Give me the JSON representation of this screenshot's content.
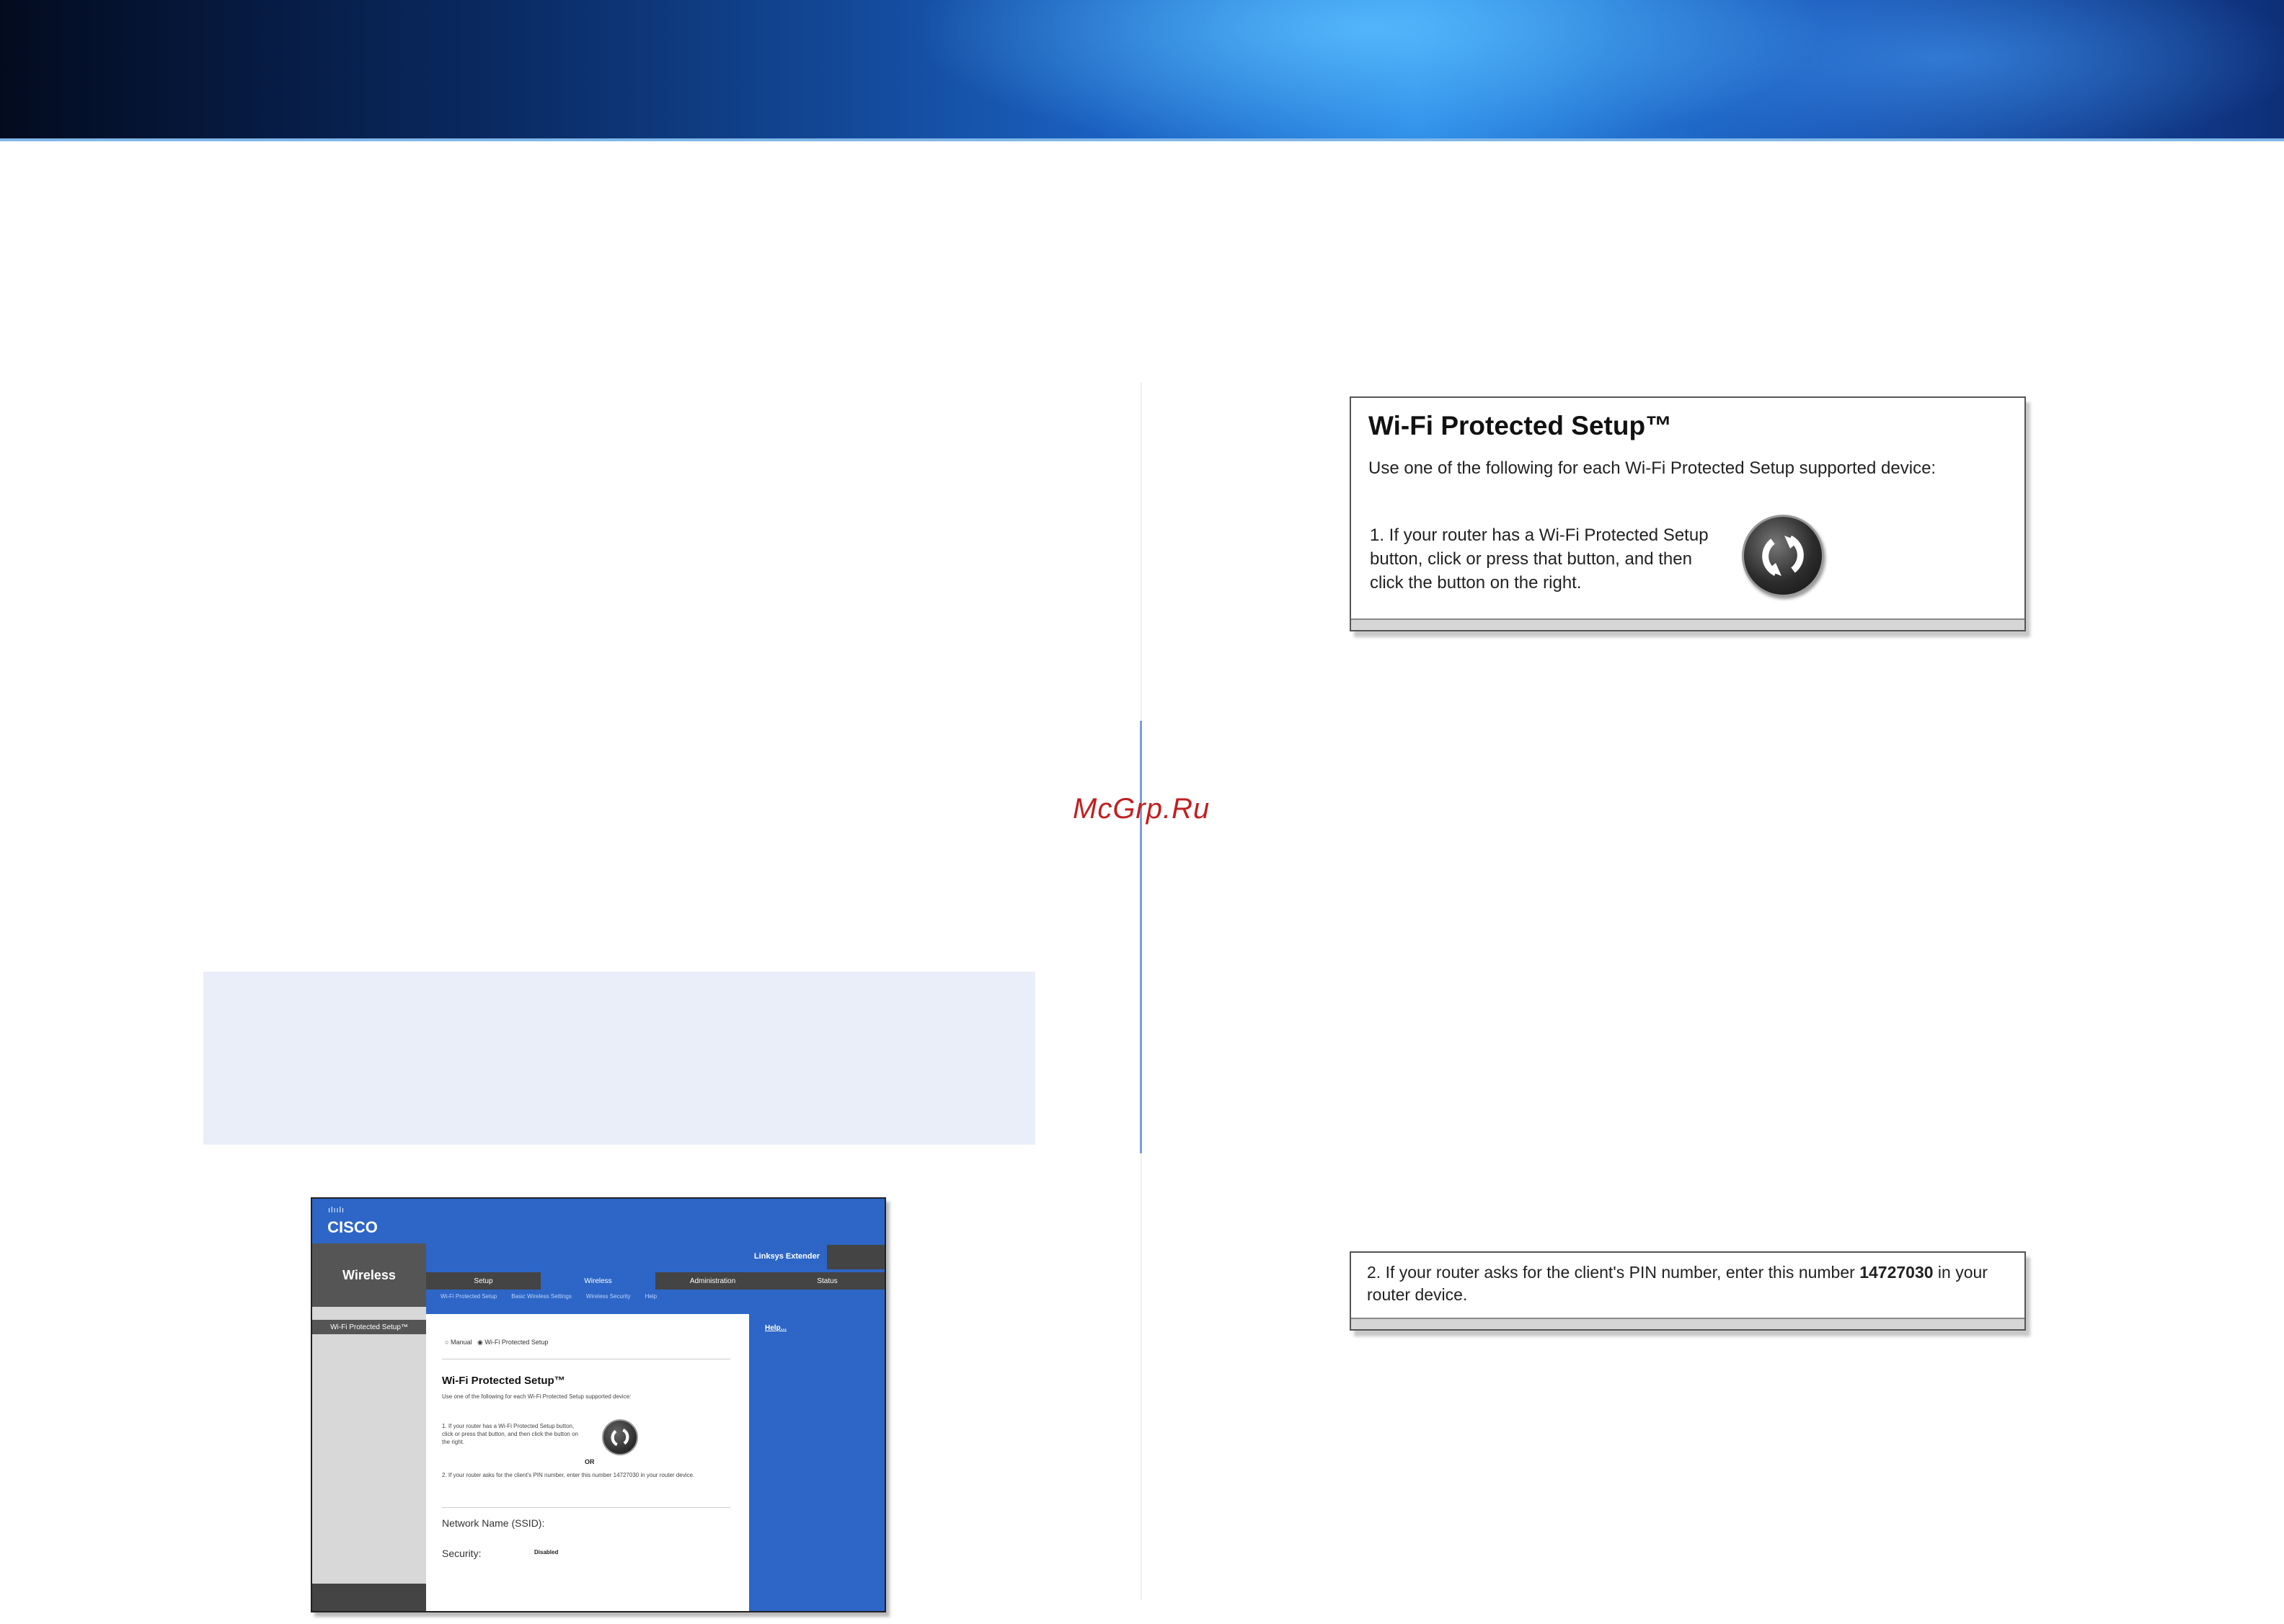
{
  "watermark": "McGrp.Ru",
  "wps_panel": {
    "title": "Wi-Fi Protected Setup™",
    "intro": "Use one of the following for each Wi-Fi Protected Setup supported device:",
    "step1": "1. If your router has a Wi-Fi Protected Setup button, click or press that button, and then click the button on the right.",
    "button_icon": "wps-icon"
  },
  "pin_panel": {
    "text_before": "2. If your router asks for the client's PIN number, enter this number ",
    "pin": "14727030",
    "text_after": " in your router device."
  },
  "screenshot": {
    "brand": "CISCO",
    "section": "Wireless",
    "subnav_item": "Wi-Fi Protected Setup™",
    "product": "Linksys Extender",
    "tabs": [
      "Setup",
      "Wireless",
      "Administration",
      "Status"
    ],
    "active_tab_index": 1,
    "subtabs": [
      "Wi-Fi Protected Setup",
      "Basic Wireless Settings",
      "Wireless Security",
      "Help"
    ],
    "radio_options": [
      "Manual",
      "Wi-Fi Protected Setup"
    ],
    "help_link": "Help...",
    "title": "Wi-Fi Protected Setup™",
    "intro": "Use one of the following for each Wi-Fi Protected Setup supported device:",
    "step1": "1. If your router has a Wi-Fi Protected Setup button, click or press that button, and then click the button on the right.",
    "or": "OR",
    "step2": "2. If your router asks for the client's PIN number, enter this number 14727030 in your router device.",
    "network_name_label": "Network Name (SSID):",
    "security_label": "Security:",
    "security_value": "Disabled"
  }
}
